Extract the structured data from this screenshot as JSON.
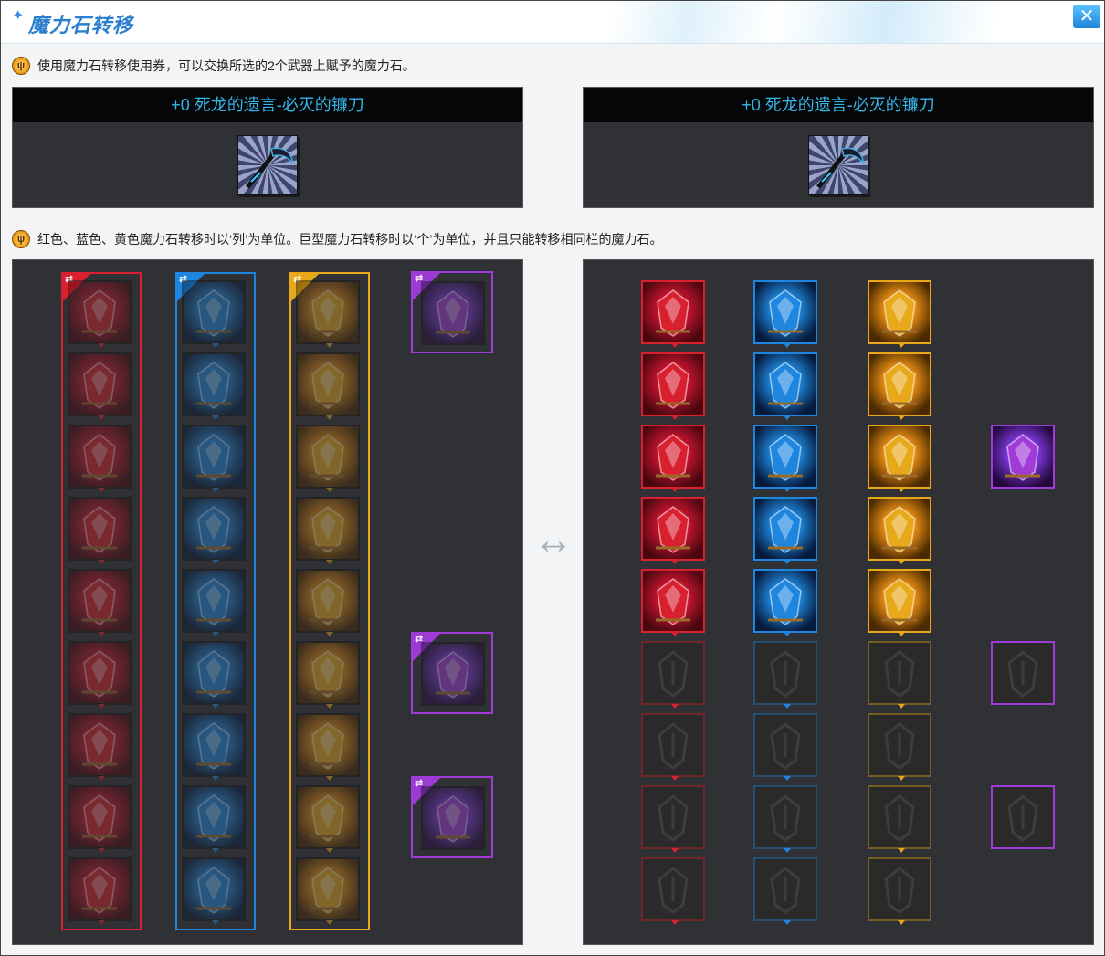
{
  "window": {
    "title": "魔力石转移",
    "close_icon": "close-x-icon"
  },
  "hints": {
    "top": "使用魔力石转移使用券，可以交换所选的2个武器上赋予的魔力石。",
    "middle": "红色、蓝色、黄色魔力石转移时以‘列’为单位。巨型魔力石转移时以‘个’为单位，并且只能转移相同栏的魔力石。",
    "icon": "gold-emblem-icon"
  },
  "weapons": [
    {
      "name": "+0  死龙的遗言-必灭的镰刀",
      "icon": "scythe-weapon-icon"
    },
    {
      "name": "+0  死龙的遗言-必灭的镰刀",
      "icon": "scythe-weapon-icon"
    }
  ],
  "swap_icon": "↔",
  "colors": {
    "red": "#d8202e",
    "blue": "#1f86df",
    "yellow": "#e7a81a",
    "purple": "#a03bd8",
    "weapon_name": "#37b6ea"
  },
  "left_panel": {
    "columns": [
      {
        "color": "red",
        "selected": true,
        "slots": [
          "filled",
          "filled",
          "filled",
          "filled",
          "filled",
          "filled",
          "filled",
          "filled",
          "filled"
        ]
      },
      {
        "color": "blue",
        "selected": true,
        "slots": [
          "filled",
          "filled",
          "filled",
          "filled",
          "filled",
          "filled",
          "filled",
          "filled",
          "filled"
        ]
      },
      {
        "color": "yellow",
        "selected": true,
        "slots": [
          "filled",
          "filled",
          "filled",
          "filled",
          "filled",
          "filled",
          "filled",
          "filled",
          "filled"
        ]
      }
    ],
    "giant": [
      "filled",
      null,
      null,
      null,
      null,
      "filled",
      null,
      "filled",
      null
    ]
  },
  "right_panel": {
    "columns": [
      {
        "color": "red",
        "slots": [
          "filled",
          "filled",
          "filled",
          "filled",
          "filled",
          "empty",
          "empty",
          "empty",
          "empty"
        ]
      },
      {
        "color": "blue",
        "slots": [
          "filled",
          "filled",
          "filled",
          "filled",
          "filled",
          "empty",
          "empty",
          "empty",
          "empty"
        ]
      },
      {
        "color": "yellow",
        "slots": [
          "filled",
          "filled",
          "filled",
          "filled",
          "filled",
          "empty",
          "empty",
          "empty",
          "empty"
        ]
      }
    ],
    "giant": [
      null,
      null,
      "filled",
      null,
      null,
      "empty",
      null,
      "empty",
      null
    ]
  }
}
